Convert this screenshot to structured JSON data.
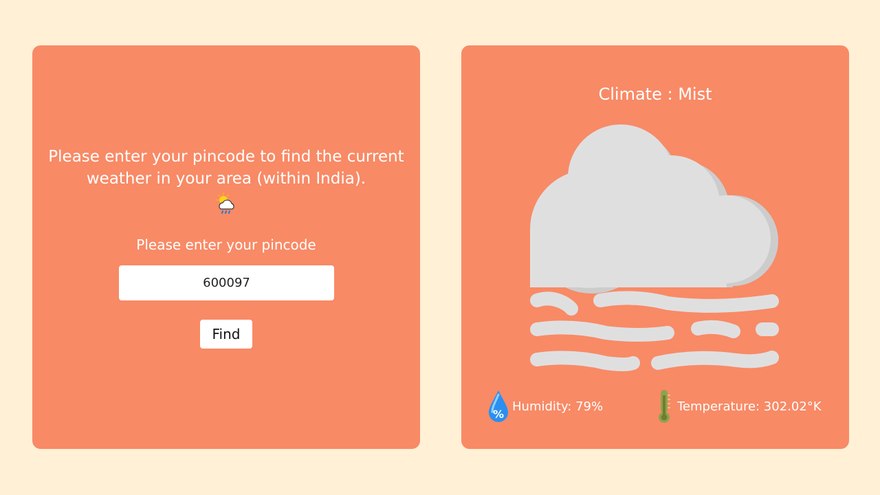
{
  "left_panel": {
    "intro_text": "Please enter your pincode to find the current weather in your area (within India).",
    "intro_icon": "sun-cloud-rain-icon",
    "pincode_label": "Please enter your pincode",
    "pincode_value": "600097",
    "find_label": "Find"
  },
  "right_panel": {
    "climate_title": "Climate : Mist",
    "weather_icon": "mist-cloud-icon",
    "humidity_text": "Humidity: 79%",
    "humidity_icon": "humidity-drop-icon",
    "temperature_text": "Temperature: 302.02°K",
    "temperature_icon": "thermometer-icon"
  },
  "colors": {
    "background": "#fff0d6",
    "card": "#f88a66",
    "cloud": "#e0dfe0",
    "cloud_shadow": "#cdcccd",
    "text": "#ffffff"
  }
}
